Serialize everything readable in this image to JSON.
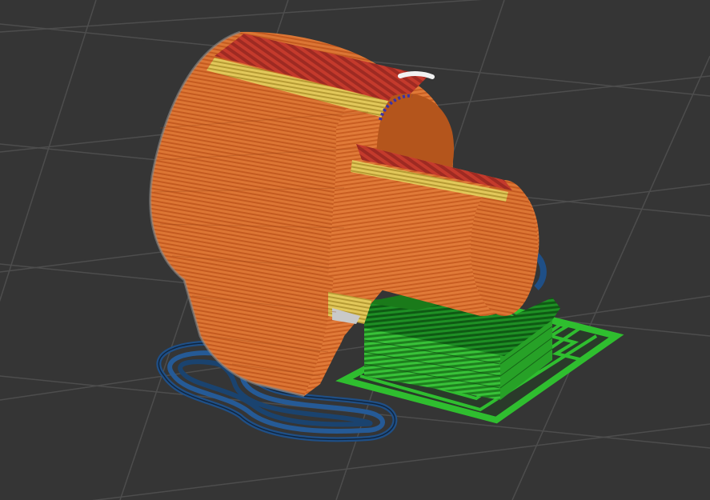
{
  "viewport": {
    "background": "#353535",
    "grid_color": "#4d4d4d"
  },
  "legend": {
    "perimeter": "#d46b2c",
    "infill": "#b83a2a",
    "skirt": "#1f4f86",
    "support": "#2fbe2f",
    "support_interface": "#1f8a1f",
    "bridge": "#d6c04a",
    "seam": "#ffffff",
    "inner_wall": "#5a4ad0"
  }
}
